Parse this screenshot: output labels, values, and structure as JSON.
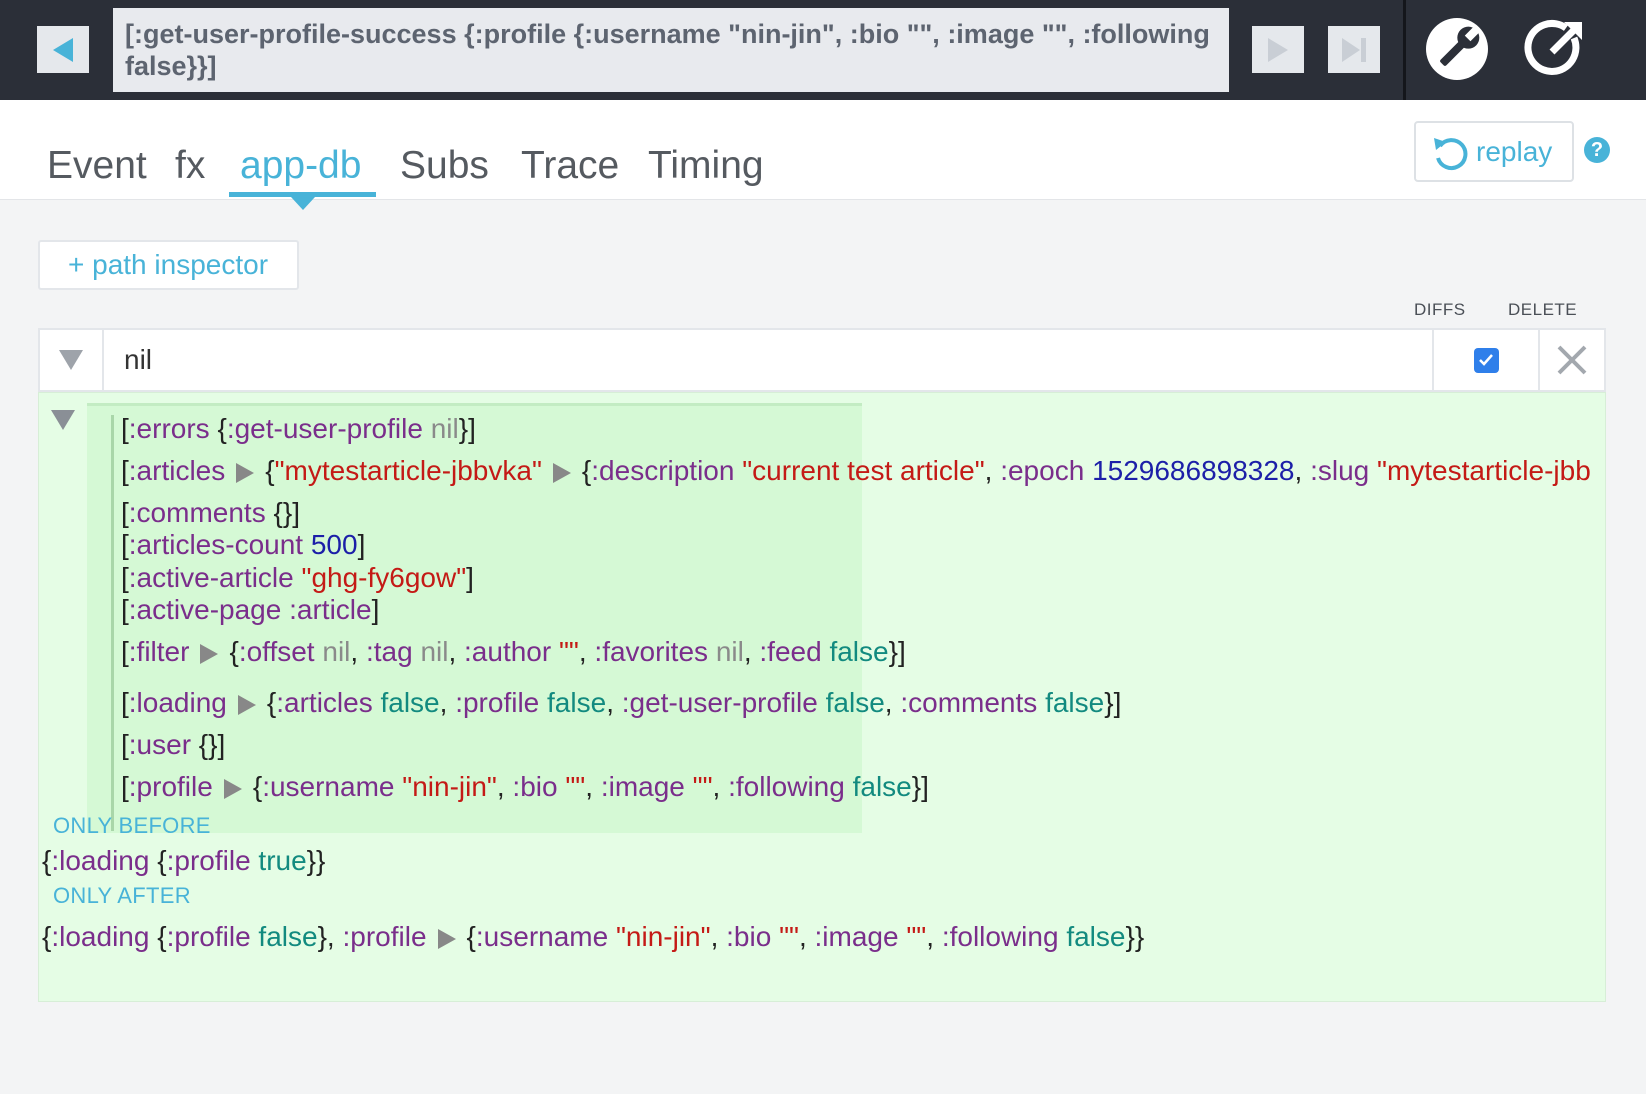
{
  "header": {
    "event_text": "[:get-user-profile-success {:profile {:username \"nin-jin\", :bio \"\", :image \"\", :following false}}]",
    "icons": [
      "back-arrow-icon",
      "forward-arrow-icon",
      "skip-to-end-icon",
      "wrench-icon",
      "pop-out-icon"
    ]
  },
  "tabs": [
    {
      "label": "Event"
    },
    {
      "label": "fx"
    },
    {
      "label": "app-db"
    },
    {
      "label": "Subs"
    },
    {
      "label": "Trace"
    },
    {
      "label": "Timing"
    }
  ],
  "active_tab": "app-db",
  "replay": {
    "label": "replay",
    "help": "?"
  },
  "path_inspector": {
    "add_label": "+ path inspector",
    "diffs_header": "DIFFS",
    "delete_header": "DELETE",
    "path_value": "nil",
    "diffs_checked": true
  },
  "db_entries": [
    {
      "key": ":errors",
      "value": "{:get-user-profile nil}"
    },
    {
      "key": ":articles",
      "value": "{\"mytestarticle-jbbvka\" {:description \"current test article\", :epoch 1529686898328, :slug \"mytestarticle-jbb"
    },
    {
      "key": ":comments",
      "value": "{}"
    },
    {
      "key": ":articles-count",
      "value": "500"
    },
    {
      "key": ":active-article",
      "value": "\"ghg-fy6gow\""
    },
    {
      "key": ":active-page",
      "value": ":article"
    },
    {
      "key": ":filter",
      "value": "{:offset nil, :tag nil, :author \"\", :favorites nil, :feed false}"
    },
    {
      "key": ":loading",
      "value": "{:articles false, :profile false, :get-user-profile false, :comments false}"
    },
    {
      "key": ":user",
      "value": "{}"
    },
    {
      "key": ":profile",
      "value": "{:username \"nin-jin\", :bio \"\", :image \"\", :following false}"
    }
  ],
  "only_before": {
    "label": "ONLY BEFORE",
    "value": "{:loading {:profile true}}"
  },
  "only_after": {
    "label": "ONLY AFTER",
    "value": "{:loading {:profile false}, :profile {:username \"nin-jin\", :bio \"\", :image \"\", :following false}}"
  },
  "colors": {
    "accent": "#48b3d8",
    "topbar": "#2b2f38",
    "diff_bg": "#e5fde5",
    "keyword": "#7a2e8b",
    "string": "#c41a16",
    "number": "#1c1fa8",
    "boolean": "#128a7f",
    "nil": "#8a8a8a"
  }
}
